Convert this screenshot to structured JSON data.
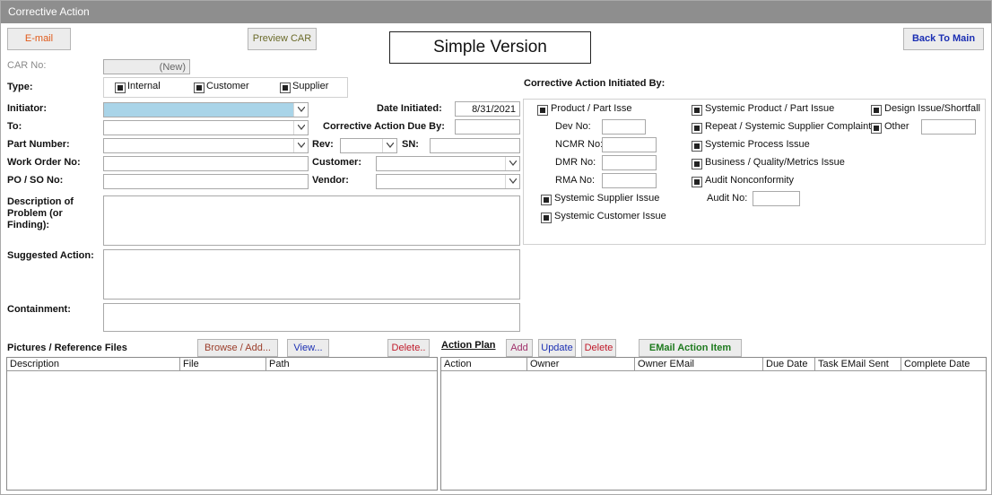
{
  "window": {
    "title": "Corrective Action"
  },
  "toolbar": {
    "email_label": "E-mail",
    "preview_label": "Preview CAR",
    "header_label": "Simple Version",
    "back_label": "Back To Main"
  },
  "colors": {
    "email_text": "#e05a1a",
    "preview_text": "#6b6b2a",
    "back_text": "#1b2fb3",
    "browse_text": "#9b3d2a",
    "view_text": "#1b2fb3",
    "delete_text": "#c01a2a",
    "add_text": "#a0306a",
    "update_text": "#1b2fb3",
    "email_action_text": "#1e7a1e",
    "initiator_fill": "#a9d4e8"
  },
  "car": {
    "label": "CAR No:",
    "value": "(New)"
  },
  "type": {
    "label": "Type:",
    "options": [
      "Internal",
      "Customer",
      "Supplier"
    ]
  },
  "fields": {
    "initiator": {
      "label": "Initiator:",
      "value": ""
    },
    "to": {
      "label": "To:",
      "value": ""
    },
    "part_number": {
      "label": "Part Number:",
      "value": ""
    },
    "work_order": {
      "label": "Work Order No:",
      "value": ""
    },
    "po_so": {
      "label": "PO / SO No:",
      "value": ""
    },
    "date_initiated": {
      "label": "Date Initiated:",
      "value": "8/31/2021"
    },
    "due_by": {
      "label": "Corrective Action Due By:",
      "value": ""
    },
    "rev": {
      "label": "Rev:",
      "value": ""
    },
    "sn": {
      "label": "SN:",
      "value": ""
    },
    "customer": {
      "label": "Customer:",
      "value": ""
    },
    "vendor": {
      "label": "Vendor:",
      "value": ""
    },
    "description": {
      "label": "Description of Problem (or Finding):",
      "value": ""
    },
    "suggested": {
      "label": "Suggested Action:",
      "value": ""
    },
    "containment": {
      "label": "Containment:",
      "value": ""
    }
  },
  "initiated_by": {
    "title": "Corrective Action Initiated By:",
    "product_part": "Product / Part Isse",
    "dev_no": "Dev No:",
    "ncmr_no": "NCMR No:",
    "dmr_no": "DMR No:",
    "rma_no": "RMA No:",
    "systemic_supplier": "Systemic Supplier Issue",
    "systemic_customer": "Systemic Customer Issue",
    "systemic_product": "Systemic Product / Part Issue",
    "repeat_supplier": "Repeat / Systemic Supplier Complaint",
    "systemic_process": "Systemic Process Issue",
    "business_quality": "Business / Quality/Metrics Issue",
    "audit_nonconformity": "Audit Nonconformity",
    "audit_no": "Audit No:",
    "design_issue": "Design Issue/Shortfall",
    "other": "Other"
  },
  "pictures": {
    "title": "Pictures / Reference Files",
    "browse_label": "Browse / Add...",
    "view_label": "View...",
    "delete_label": "Delete..",
    "columns": [
      "Description",
      "File",
      "Path"
    ],
    "rows": []
  },
  "action_plan": {
    "title": "Action Plan",
    "add_label": "Add",
    "update_label": "Update",
    "delete_label": "Delete",
    "email_label": "EMail Action Item",
    "columns": [
      "Action",
      "Owner",
      "Owner EMail",
      "Due Date",
      "Task EMail Sent",
      "Complete Date"
    ],
    "rows": []
  }
}
